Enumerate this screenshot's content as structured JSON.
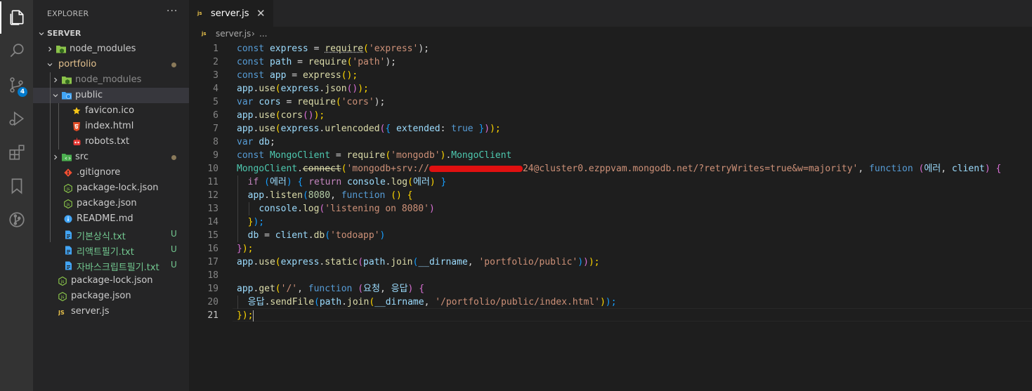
{
  "activity_bar": {
    "items": [
      {
        "name": "explorer-icon",
        "active": true
      },
      {
        "name": "search-icon",
        "active": false
      },
      {
        "name": "source-control-icon",
        "active": false,
        "badge": "4"
      },
      {
        "name": "run-debug-icon",
        "active": false
      },
      {
        "name": "extensions-icon",
        "active": false
      },
      {
        "name": "bookmarks-icon",
        "active": false
      },
      {
        "name": "git-graph-icon",
        "active": false
      }
    ]
  },
  "sidebar": {
    "title": "EXPLORER",
    "more": "···",
    "root": "SERVER",
    "items": [
      {
        "label": "node_modules",
        "type": "folder",
        "expanded": false,
        "level": 0,
        "color": "#cccccc"
      },
      {
        "label": "portfolio",
        "type": "folder",
        "expanded": true,
        "level": 0,
        "color": "#e2c08d",
        "dot": true
      },
      {
        "label": "node_modules",
        "type": "folder",
        "expanded": false,
        "level": 1,
        "color": "#8c8c8c"
      },
      {
        "label": "public",
        "type": "folder",
        "expanded": true,
        "level": 1,
        "color": "#cccccc",
        "selected": true
      },
      {
        "label": "favicon.ico",
        "type": "file",
        "icon": "star-icon",
        "level": 2,
        "color": "#cccccc"
      },
      {
        "label": "index.html",
        "type": "file",
        "icon": "html5-icon",
        "level": 2,
        "color": "#cccccc"
      },
      {
        "label": "robots.txt",
        "type": "file",
        "icon": "robot-icon",
        "level": 2,
        "color": "#cccccc"
      },
      {
        "label": "src",
        "type": "folder",
        "expanded": false,
        "level": 1,
        "color": "#cccccc",
        "dot": true
      },
      {
        "label": ".gitignore",
        "type": "file",
        "icon": "git-icon",
        "level": 1,
        "color": "#cccccc"
      },
      {
        "label": "package-lock.json",
        "type": "file",
        "icon": "node-icon",
        "level": 1,
        "color": "#cccccc"
      },
      {
        "label": "package.json",
        "type": "file",
        "icon": "node-icon",
        "level": 1,
        "color": "#cccccc"
      },
      {
        "label": "README.md",
        "type": "file",
        "icon": "info-icon",
        "level": 1,
        "color": "#cccccc"
      },
      {
        "label": "기본상식.txt",
        "type": "file",
        "icon": "text-file-icon",
        "level": 1,
        "color": "#73c991",
        "status": "U"
      },
      {
        "label": "리액트필기.txt",
        "type": "file",
        "icon": "text-file-icon",
        "level": 1,
        "color": "#73c991",
        "status": "U"
      },
      {
        "label": "자바스크립트필기.txt",
        "type": "file",
        "icon": "text-file-icon",
        "level": 1,
        "color": "#73c991",
        "status": "U"
      },
      {
        "label": "package-lock.json",
        "type": "file",
        "icon": "node-icon",
        "level": 0,
        "color": "#cccccc"
      },
      {
        "label": "package.json",
        "type": "file",
        "icon": "node-icon",
        "level": 0,
        "color": "#cccccc"
      },
      {
        "label": "server.js",
        "type": "file",
        "icon": "js-icon",
        "level": 0,
        "color": "#cccccc"
      }
    ]
  },
  "tab": {
    "icon": "js",
    "label": "server.js",
    "close": "✕"
  },
  "breadcrumb": {
    "icon": "js",
    "file": "server.js",
    "sep": "›",
    "more": "..."
  },
  "editor": {
    "current_line": 21,
    "lines": [
      "1",
      "2",
      "3",
      "4",
      "5",
      "6",
      "7",
      "8",
      "9",
      "10",
      "11",
      "12",
      "13",
      "14",
      "15",
      "16",
      "17",
      "18",
      "19",
      "20",
      "21"
    ],
    "code": {
      "l1": [
        "const",
        "express",
        "=",
        "require",
        "(",
        "'express'",
        ");"
      ],
      "l2": [
        "const",
        "path",
        "=",
        "require",
        "(",
        "'path'",
        ");"
      ],
      "l3": [
        "const",
        "app",
        "=",
        "express",
        "();"
      ],
      "l4": [
        "app",
        ".",
        "use",
        "(",
        "express",
        ".",
        "json",
        "()",
        ");"
      ],
      "l5": [
        "var",
        "cors",
        "=",
        "require",
        "(",
        "'cors'",
        ");"
      ],
      "l6": [
        "app",
        ".",
        "use",
        "(",
        "cors",
        "()",
        ");"
      ],
      "l7": [
        "app",
        ".",
        "use",
        "(",
        "express",
        ".",
        "urlencoded",
        "(",
        "{",
        "extended",
        ":",
        "true",
        "}",
        ")",
        ");"
      ],
      "l8": [
        "var",
        "db",
        ";"
      ],
      "l9": [
        "const",
        "MongoClient",
        "=",
        "require",
        "(",
        "'mongodb'",
        ")",
        ".",
        "MongoClient"
      ],
      "l10_a": [
        "MongoClient",
        ".",
        "connect",
        "(",
        "'mongodb+srv://"
      ],
      "l10_b": [
        "24@cluster0.ezppvam.mongodb.net/?retryWrites=true&w=majority'",
        ",",
        "function",
        "(",
        "에러",
        ",",
        "client",
        ")",
        "{"
      ],
      "l11": [
        "if",
        "(",
        "에러",
        ")",
        "{",
        "return",
        "console",
        ".",
        "log",
        "(",
        "에러",
        ")",
        "}"
      ],
      "l12": [
        "app",
        ".",
        "listen",
        "(",
        "8080",
        ",",
        "function",
        "()",
        "{"
      ],
      "l13": [
        "console",
        ".",
        "log",
        "(",
        "'listening on 8080'",
        ")"
      ],
      "l14": [
        "}",
        ");"
      ],
      "l15": [
        "db",
        "=",
        "client",
        ".",
        "db",
        "(",
        "'todoapp'",
        ")"
      ],
      "l16": [
        "}",
        ");"
      ],
      "l17": [
        "app",
        ".",
        "use",
        "(",
        "express",
        ".",
        "static",
        "(",
        "path",
        ".",
        "join",
        "(",
        "__dirname",
        ",",
        "'portfolio/public'",
        ")",
        ")",
        ");"
      ],
      "l19": [
        "app",
        ".",
        "get",
        "(",
        "'/'",
        ",",
        "function",
        "(",
        "요청",
        ",",
        "응답",
        ")",
        "{"
      ],
      "l20": [
        "응답",
        ".",
        "sendFile",
        "(",
        "path",
        ".",
        "join",
        "(",
        "__dirname",
        ",",
        "'/portfolio/public/index.html'",
        ")",
        ");"
      ],
      "l21": [
        "}",
        ");"
      ]
    }
  }
}
